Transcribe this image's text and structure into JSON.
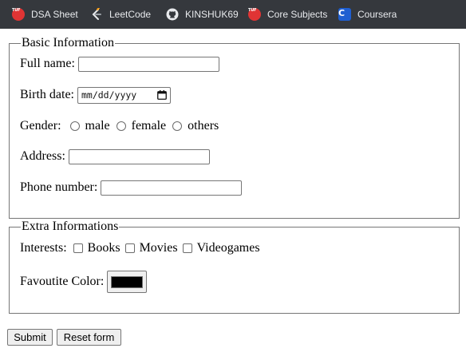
{
  "bookmarks": [
    {
      "label": "DSA Sheet",
      "icon": "tuf-logo-icon",
      "icon_text": "TUF"
    },
    {
      "label": "LeetCode",
      "icon": "leetcode-icon"
    },
    {
      "label": "KINSHUK69",
      "icon": "github-icon"
    },
    {
      "label": "Core Subjects",
      "icon": "tuf-logo-icon",
      "icon_text": "TUF"
    },
    {
      "label": "Coursera",
      "icon": "coursera-icon",
      "icon_text": "C"
    }
  ],
  "basic": {
    "legend": "Basic Information",
    "full_name_label": "Full name:",
    "full_name_value": "",
    "birth_date_label": "Birth date:",
    "birth_date_placeholder": "mm/dd/yyyy",
    "gender_label": "Gender:",
    "gender_options": [
      "male",
      "female",
      "others"
    ],
    "address_label": "Address:",
    "address_value": "",
    "phone_label": "Phone number:",
    "phone_value": ""
  },
  "extra": {
    "legend": "Extra Informations",
    "interests_label": "Interests:",
    "interests_options": [
      "Books",
      "Movies",
      "Videogames"
    ],
    "color_label": "Favoutite Color:",
    "color_value": "#000000"
  },
  "buttons": {
    "submit": "Submit",
    "reset": "Reset form"
  }
}
